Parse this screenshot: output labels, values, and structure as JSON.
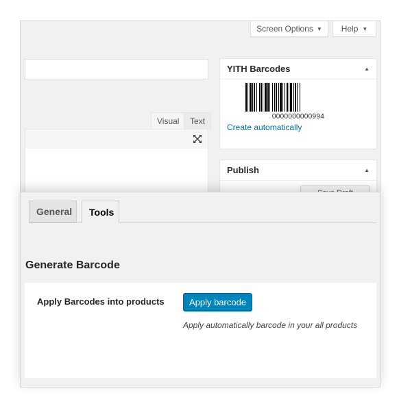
{
  "header": {
    "screen_options_label": "Screen Options",
    "help_label": "Help"
  },
  "editor": {
    "visual_tab": "Visual",
    "text_tab": "Text"
  },
  "barcode_box": {
    "title": "YITH Barcodes",
    "barcode_value": "0000000000994",
    "create_link": "Create automatically"
  },
  "publish_box": {
    "title": "Publish",
    "button_partial": "Save Draft"
  },
  "tabs": [
    {
      "label": "General",
      "active": false
    },
    {
      "label": "Tools",
      "active": true
    }
  ],
  "tools": {
    "section_title": "Generate Barcode",
    "field_label": "Apply Barcodes into products",
    "apply_button": "Apply barcode",
    "description": "Apply automatically barcode in your all products"
  },
  "colors": {
    "primary_button": "#0085ba",
    "link": "#0073aa",
    "background": "#f1f1f1"
  }
}
